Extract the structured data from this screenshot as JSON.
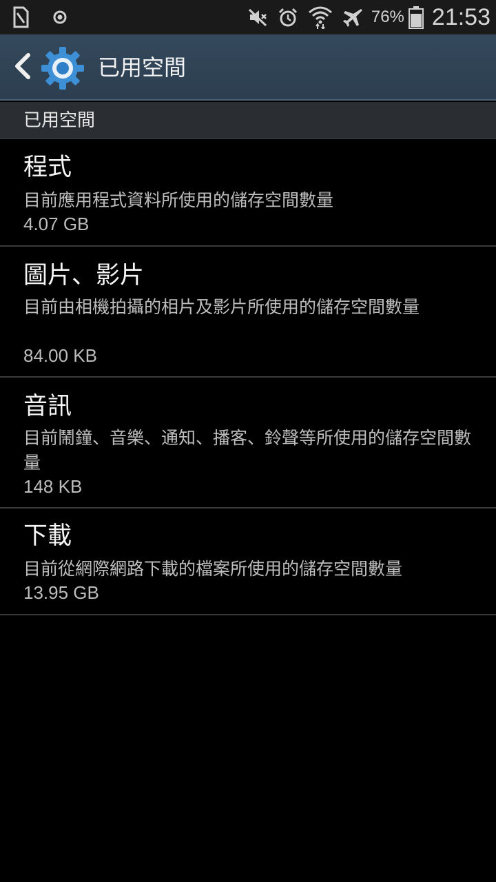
{
  "status_bar": {
    "battery_percent": "76%",
    "time": "21:53",
    "icons": [
      "sim-card-icon",
      "location-target-icon",
      "mute-icon",
      "alarm-icon",
      "wifi-icon",
      "airplane-mode-icon",
      "battery-icon"
    ]
  },
  "action_bar": {
    "title": "已用空間",
    "back_icon": "chevron-left-icon",
    "app_icon": "gear-icon",
    "accent_color": "#2c3e50"
  },
  "section": {
    "header": "已用空間"
  },
  "items": [
    {
      "title": "程式",
      "description": "目前應用程式資料所使用的儲存空間數量",
      "value": "4.07 GB"
    },
    {
      "title": "圖片、影片",
      "description": "目前由相機拍攝的相片及影片所使用的儲存空間數量",
      "value": "84.00 KB"
    },
    {
      "title": "音訊",
      "description": "目前鬧鐘、音樂、通知、播客、鈴聲等所使用的儲存空間數量",
      "value": "148 KB"
    },
    {
      "title": "下載",
      "description": "目前從網際網路下載的檔案所使用的儲存空間數量",
      "value": "13.95 GB"
    }
  ]
}
